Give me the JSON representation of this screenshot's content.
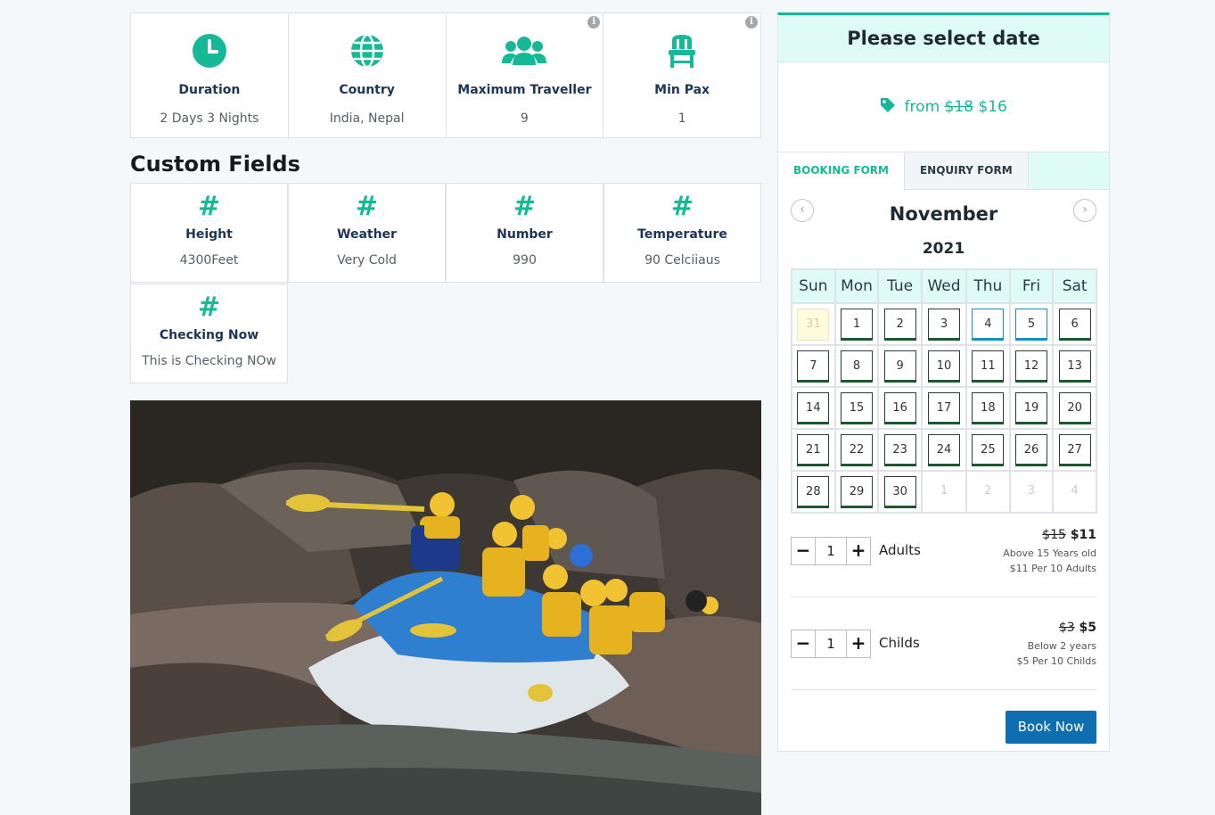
{
  "facts": [
    {
      "icon": "clock-icon",
      "title": "Duration",
      "value": "2 Days 3 Nights"
    },
    {
      "icon": "globe-icon",
      "title": "Country",
      "value": "India, Nepal"
    },
    {
      "icon": "users-icon",
      "title": "Maximum Traveller",
      "value": "9"
    },
    {
      "icon": "chair-icon",
      "title": "Min Pax",
      "value": "1"
    }
  ],
  "custom_fields": {
    "heading": "Custom Fields",
    "items": [
      {
        "icon": "hash-icon",
        "title": "Height",
        "value": "4300Feet"
      },
      {
        "icon": "hash-icon",
        "title": "Weather",
        "value": "Very Cold"
      },
      {
        "icon": "hash-icon",
        "title": "Number",
        "value": "990"
      },
      {
        "icon": "hash-icon",
        "title": "Temperature",
        "value": "90 Celciiaus"
      },
      {
        "icon": "hash-icon",
        "title": "Checking Now",
        "value": "This is Checking NOw"
      }
    ]
  },
  "booking": {
    "header": "Please select date",
    "price_prefix": "from",
    "price_old": "$18",
    "price_new": "$16",
    "tabs": [
      "BOOKING FORM",
      "ENQUIRY FORM"
    ],
    "month": "November",
    "year": "2021",
    "weekdays": [
      "Sun",
      "Mon",
      "Tue",
      "Wed",
      "Thu",
      "Fri",
      "Sat"
    ],
    "weeks": [
      [
        "31",
        "1",
        "2",
        "3",
        "4",
        "5",
        "6"
      ],
      [
        "7",
        "8",
        "9",
        "10",
        "11",
        "12",
        "13"
      ],
      [
        "14",
        "15",
        "16",
        "17",
        "18",
        "19",
        "20"
      ],
      [
        "21",
        "22",
        "23",
        "24",
        "25",
        "26",
        "27"
      ],
      [
        "28",
        "29",
        "30",
        "1",
        "2",
        "3",
        "4"
      ]
    ],
    "adults": {
      "label": "Adults",
      "qty": "1",
      "price_old": "$15",
      "price_new": "$11",
      "note1": "Above 15 Years old",
      "note2": "$11 Per 10 Adults"
    },
    "childs": {
      "label": "Childs",
      "qty": "1",
      "price_old": "$3",
      "price_new": "$5",
      "note1": "Below 2 years",
      "note2": "$5 Per 10 Childs"
    },
    "book_label": "Book Now",
    "minus": "−",
    "plus": "+"
  },
  "colors": {
    "accent": "#17b897",
    "book_button": "#0e6eb0",
    "header_bg": "#dffbf6"
  }
}
